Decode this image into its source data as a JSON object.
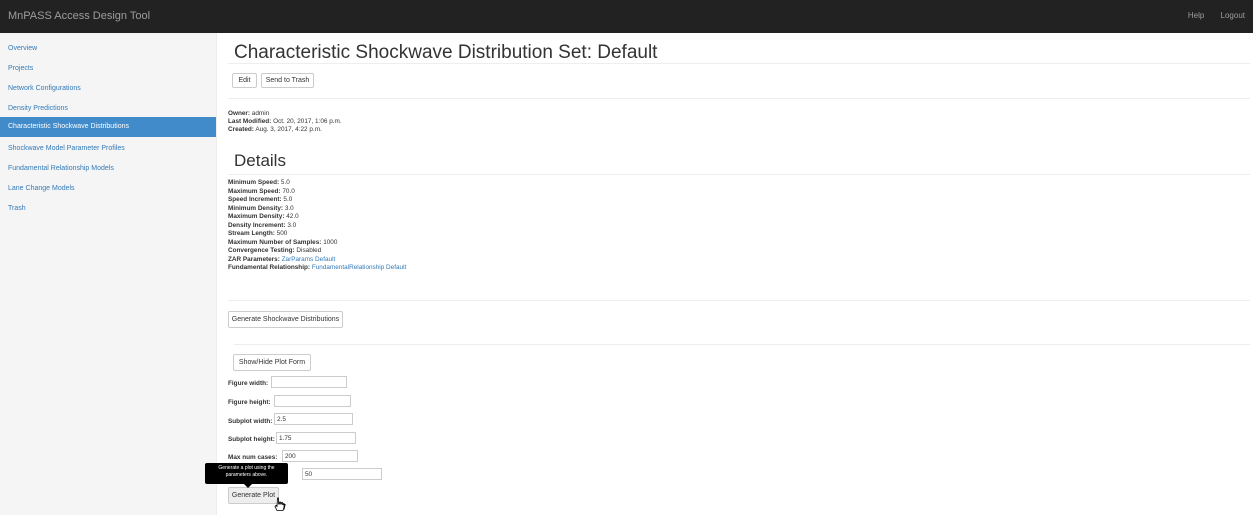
{
  "app": {
    "title": "MnPASS Access Design Tool",
    "nav": [
      "Help",
      "Logout"
    ]
  },
  "sidebar": {
    "items": [
      {
        "label": "Overview",
        "active": false
      },
      {
        "label": "Projects",
        "active": false
      },
      {
        "label": "Network Configurations",
        "active": false
      },
      {
        "label": "Density Predictions",
        "active": false
      },
      {
        "label": "Characteristic Shockwave Distributions",
        "active": true
      },
      {
        "label": "Shockwave Model Parameter Profiles",
        "active": false
      },
      {
        "label": "Fundamental Relationship Models",
        "active": false
      },
      {
        "label": "Lane Change Models",
        "active": false
      },
      {
        "label": "Trash",
        "active": false
      }
    ]
  },
  "page": {
    "title": "Characteristic Shockwave Distribution Set: Default",
    "edit_label": "Edit",
    "trash_label": "Send to Trash",
    "owner_label": "Owner:",
    "owner": "admin",
    "modified_label": "Last Modified:",
    "modified": "Oct. 20, 2017, 1:06 p.m.",
    "created_label": "Created:",
    "created": "Aug. 3, 2017, 4:22 p.m."
  },
  "details": {
    "title": "Details",
    "rows": [
      {
        "label": "Minimum Speed:",
        "value": "5.0"
      },
      {
        "label": "Maximum Speed:",
        "value": "70.0"
      },
      {
        "label": "Speed Increment:",
        "value": "5.0"
      },
      {
        "label": "Minimum Density:",
        "value": "3.0"
      },
      {
        "label": "Maximum Density:",
        "value": "42.0"
      },
      {
        "label": "Density Increment:",
        "value": "3.0"
      },
      {
        "label": "Stream Length:",
        "value": "500"
      },
      {
        "label": "Maximum Number of Samples:",
        "value": "1000"
      },
      {
        "label": "Convergence Testing:",
        "value": "Disabled"
      }
    ],
    "zar_label": "ZAR Parameters:",
    "zar_link": "ZarParams Default",
    "fr_label": "Fundamental Relationship:",
    "fr_link": "FundamentalRelationship Default"
  },
  "actions": {
    "generate_distributions_label": "Generate Shockwave Distributions",
    "toggle_plot_form_label": "Show/Hide Plot Form"
  },
  "plot_form": {
    "fig_width_label": "Figure width:",
    "fig_width": "",
    "fig_height_label": "Figure height:",
    "fig_height": "",
    "subplot_width_label": "Subplot width:",
    "subplot_width": "2.5",
    "subplot_height_label": "Subplot height:",
    "subplot_height": "1.75",
    "max_cases_label": "Max num cases:",
    "max_cases": "200",
    "hidden_field_value": "50",
    "generate_plot_label": "Generate Plot",
    "tooltip_line1": "Generate a plot using the",
    "tooltip_line2": "parameters above."
  }
}
